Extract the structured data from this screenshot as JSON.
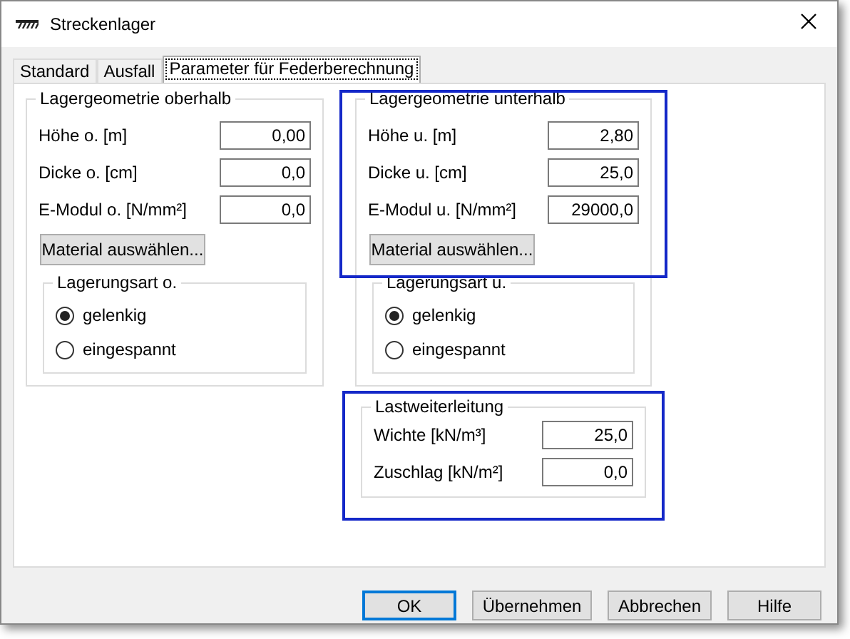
{
  "window": {
    "title": "Streckenlager"
  },
  "tabs": [
    {
      "label": "Standard",
      "selected": false
    },
    {
      "label": "Ausfall",
      "selected": false
    },
    {
      "label": "Parameter für Federberechnung",
      "selected": true
    }
  ],
  "columns": [
    {
      "geometry": {
        "title": "Lagergeometrie oberhalb",
        "highlighted": false,
        "fields": [
          {
            "label": "Höhe o. [m]",
            "value": "0,00"
          },
          {
            "label": "Dicke o. [cm]",
            "value": "0,0"
          },
          {
            "label": "E-Modul o. [N/mm²]",
            "value": "0,0"
          }
        ],
        "button": "Material auswählen..."
      },
      "support": {
        "title": "Lagerungsart o.",
        "options": [
          {
            "label": "gelenkig",
            "selected": true
          },
          {
            "label": "eingespannt",
            "selected": false
          }
        ]
      }
    },
    {
      "geometry": {
        "title": "Lagergeometrie unterhalb",
        "highlighted": true,
        "fields": [
          {
            "label": "Höhe u. [m]",
            "value": "2,80"
          },
          {
            "label": "Dicke u. [cm]",
            "value": "25,0"
          },
          {
            "label": "E-Modul u. [N/mm²]",
            "value": "29000,0"
          }
        ],
        "button": "Material auswählen..."
      },
      "support": {
        "title": "Lagerungsart u.",
        "options": [
          {
            "label": "gelenkig",
            "selected": true
          },
          {
            "label": "eingespannt",
            "selected": false
          }
        ]
      },
      "load": {
        "title": "Lastweiterleitung",
        "highlighted": true,
        "fields": [
          {
            "label": "Wichte [kN/m³]",
            "value": "25,0"
          },
          {
            "label": "Zuschlag [kN/m²]",
            "value": "0,0"
          }
        ]
      }
    }
  ],
  "buttons": [
    {
      "label": "OK",
      "default": true
    },
    {
      "label": "Übernehmen",
      "default": false
    },
    {
      "label": "Abbrechen",
      "default": false
    },
    {
      "label": "Hilfe",
      "default": false
    }
  ]
}
